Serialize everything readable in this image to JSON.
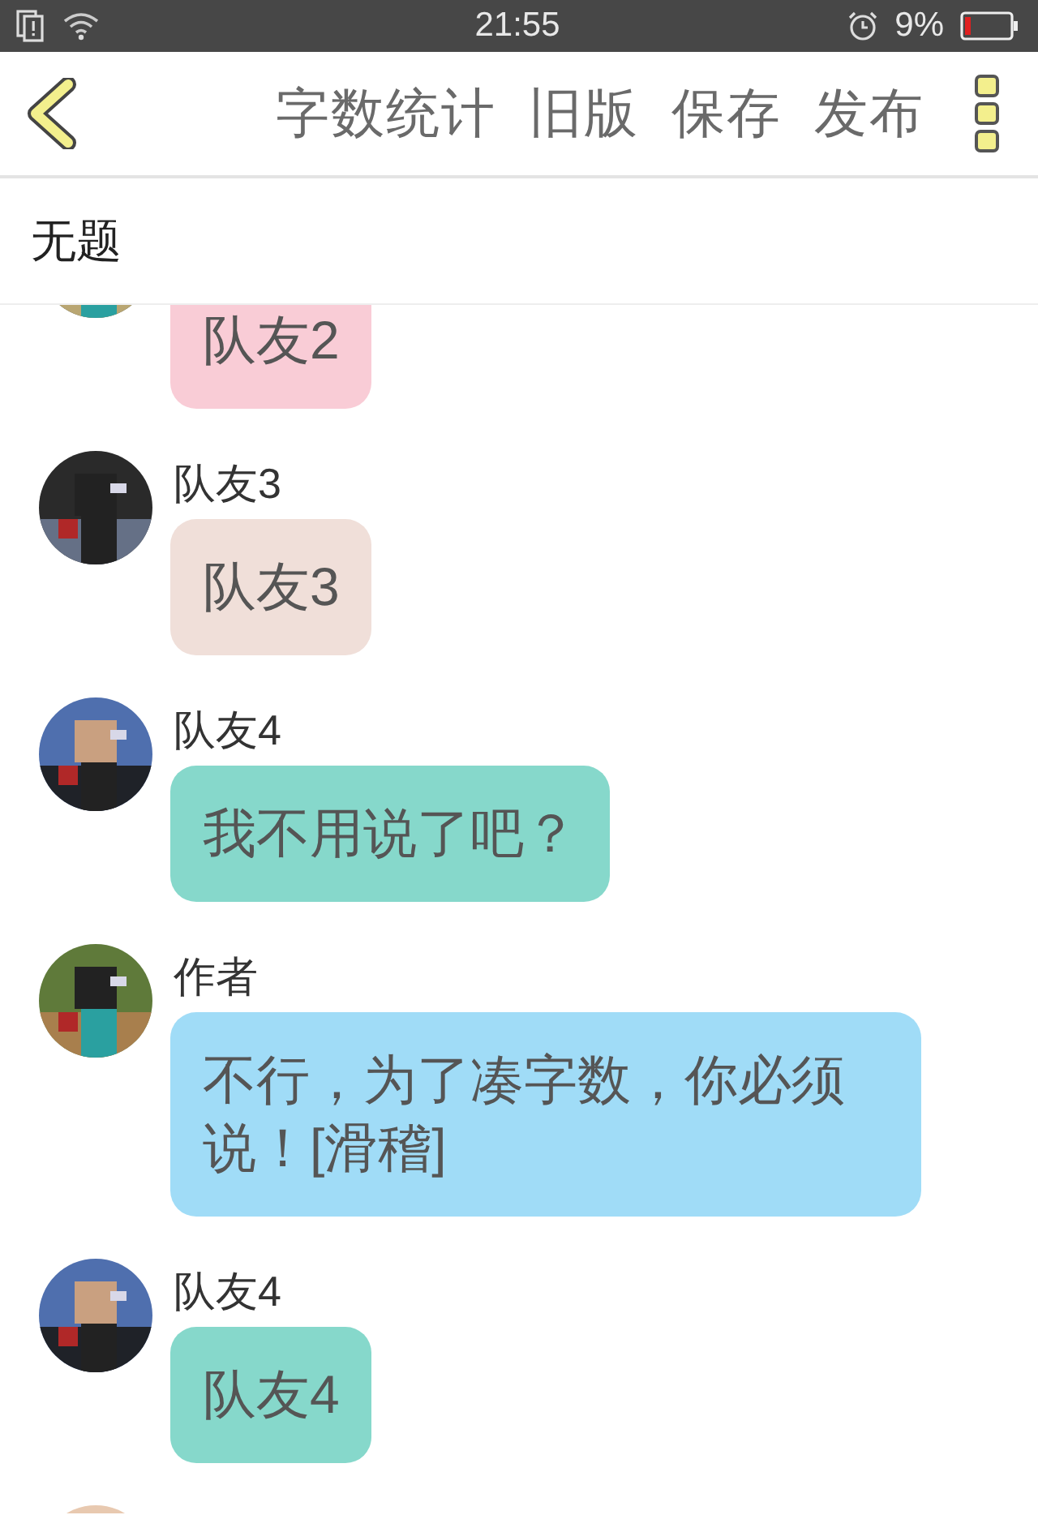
{
  "status_bar": {
    "time": "21:55",
    "battery": "9%"
  },
  "header": {
    "actions": [
      "字数统计",
      "旧版",
      "保存",
      "发布"
    ]
  },
  "title": "无题",
  "messages": [
    {
      "avatar": {
        "kind": "picture"
      },
      "text": "队友2",
      "color": "#f9ccd6"
    },
    {
      "avatar": {
        "kind": "picture"
      },
      "name": "队友3",
      "text": "队友3",
      "color": "#f0dfd9"
    },
    {
      "avatar": {
        "kind": "picture"
      },
      "name": "队友4",
      "text": "我不用说了吧？",
      "color": "#86d8cb"
    },
    {
      "avatar": {
        "kind": "picture"
      },
      "name": "作者",
      "text": "不行，为了凑字数，你必须说！[滑稽]",
      "color": "#a0dcf7"
    },
    {
      "avatar": {
        "kind": "picture"
      },
      "name": "队友4",
      "text": "队友4",
      "color": "#86d8cb"
    },
    {
      "avatar": {
        "kind": "picture"
      }
    }
  ]
}
